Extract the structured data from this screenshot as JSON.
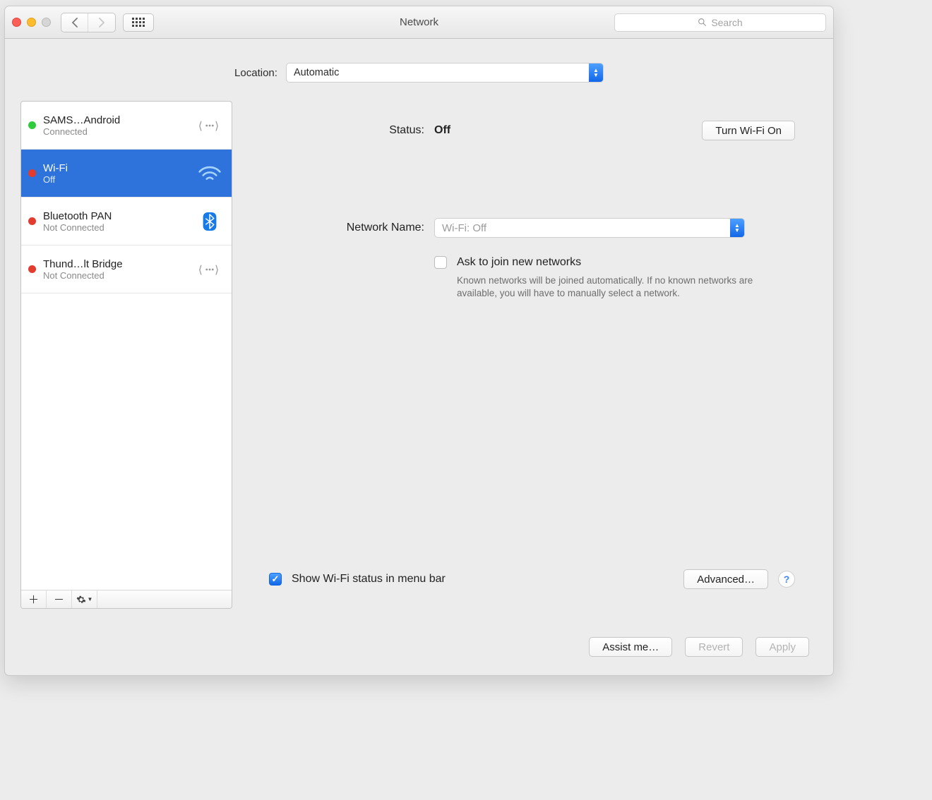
{
  "window": {
    "title": "Network",
    "search_placeholder": "Search"
  },
  "location": {
    "label": "Location:",
    "value": "Automatic"
  },
  "services": [
    {
      "name": "SAMS…Android",
      "status": "Connected",
      "dot": "green",
      "icon": "ethernet",
      "selected": false
    },
    {
      "name": "Wi-Fi",
      "status": "Off",
      "dot": "red",
      "icon": "wifi",
      "selected": true
    },
    {
      "name": "Bluetooth PAN",
      "status": "Not Connected",
      "dot": "red",
      "icon": "bluetooth",
      "selected": false
    },
    {
      "name": "Thund…lt Bridge",
      "status": "Not Connected",
      "dot": "red",
      "icon": "ethernet",
      "selected": false
    }
  ],
  "detail": {
    "status_label": "Status:",
    "status_value": "Off",
    "turn_on_label": "Turn Wi-Fi On",
    "network_name_label": "Network Name:",
    "network_name_value": "Wi-Fi: Off",
    "ask_label": "Ask to join new networks",
    "ask_checked": false,
    "ask_description": "Known networks will be joined automatically. If no known networks are available, you will have to manually select a network.",
    "show_menubar_label": "Show Wi-Fi status in menu bar",
    "show_menubar_checked": true,
    "advanced_label": "Advanced…"
  },
  "footer": {
    "assist": "Assist me…",
    "revert": "Revert",
    "apply": "Apply"
  }
}
